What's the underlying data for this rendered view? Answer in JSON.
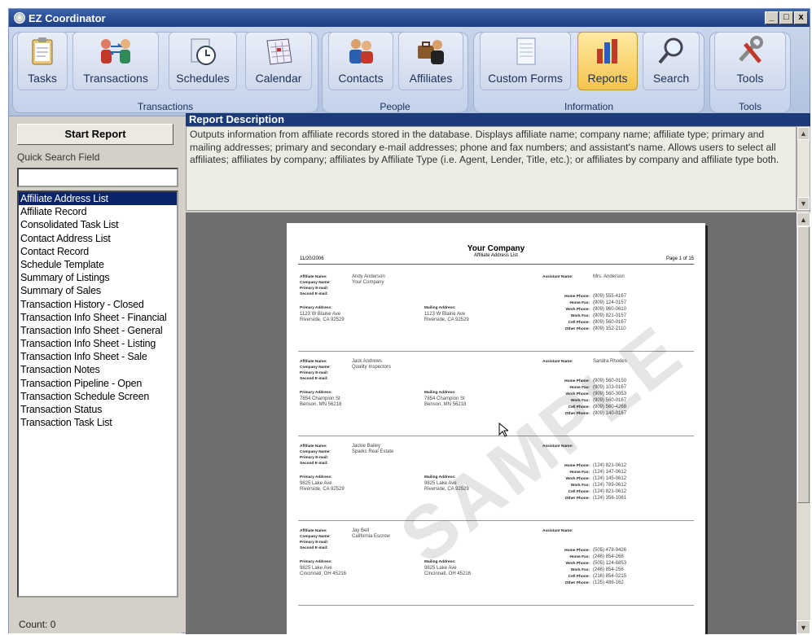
{
  "window": {
    "title": "EZ Coordinator",
    "minimize": "_",
    "restore": "□",
    "close": "x"
  },
  "ribbon": {
    "groups": [
      {
        "label": "Transactions"
      },
      {
        "label": "People"
      },
      {
        "label": "Information"
      },
      {
        "label": "Tools"
      }
    ],
    "buttons": [
      {
        "label": "Tasks",
        "icon": "clipboard-icon"
      },
      {
        "label": "Transactions",
        "icon": "people-exchange-icon"
      },
      {
        "label": "Schedules",
        "icon": "clock-icon"
      },
      {
        "label": "Calendar",
        "icon": "calendar-icon"
      },
      {
        "label": "Contacts",
        "icon": "contacts-icon"
      },
      {
        "label": "Affiliates",
        "icon": "briefcase-person-icon"
      },
      {
        "label": "Custom Forms",
        "icon": "form-icon"
      },
      {
        "label": "Reports",
        "icon": "bar-chart-icon"
      },
      {
        "label": "Search",
        "icon": "magnifier-icon"
      },
      {
        "label": "Tools",
        "icon": "wrench-icon"
      }
    ]
  },
  "left": {
    "start_report": "Start Report",
    "quick_search_label": "Quick Search Field",
    "quick_search_value": "",
    "reports": [
      "Affiliate Address List",
      "Affiliate Record",
      "Consolidated Task List",
      "Contact Address List",
      "Contact Record",
      "Schedule Template",
      "Summary of Listings",
      "Summary of Sales",
      "Transaction History - Closed",
      "Transaction Info Sheet - Financial",
      "Transaction Info Sheet - General",
      "Transaction Info Sheet - Listing",
      "Transaction Info Sheet - Sale",
      "Transaction Notes",
      "Transaction Pipeline - Open",
      "Transaction Schedule Screen",
      "Transaction Status",
      "Transaction Task List"
    ],
    "selected_index": 0,
    "count": "Count: 0"
  },
  "description": {
    "heading": "Report Description",
    "text": "Outputs information from affiliate records stored in the database. Displays affiliate name; company name; affiliate type; primary and mailing addresses; primary and secondary e-mail addresses; phone and fax numbers; and assistant's name. Allows users to select all affiliates; affiliates by company; affiliates by Affiliate Type (i.e. Agent, Lender, Title, etc.); or affiliates by company and affiliate type both."
  },
  "preview": {
    "company": "Your Company",
    "subtitle": "Affiliate Address List",
    "date": "11/20/2006",
    "page": "Page 1 of 15",
    "watermark": "SAMPLE",
    "labels": {
      "name": "Affiliate Name:",
      "company": "Company Name:",
      "email1": "Primary E-mail:",
      "email2": "Second E-mail:",
      "paddr": "Primary Address:",
      "maddr": "Mailing Address:",
      "assistant": "Assistant Name:",
      "home": "Home Phone:",
      "homefax": "Home Fax:",
      "work": "Work Phone:",
      "workfax": "Work Fax:",
      "cell": "Cell Phone:",
      "other": "Other Phone:"
    },
    "records": [
      {
        "name": "Andy Anderson",
        "company": "Your Company",
        "assistant": "Mrs. Anderson",
        "paddr1": "1123 W Blaine Ave",
        "paddr2": "Riverside, CA 92529",
        "maddr1": "1123 W Blaine Ave",
        "maddr2": "Riverside, CA 92529",
        "phones": [
          "(909) 555-4167",
          "(909) 124-0157",
          "(909) 960-0610",
          "(909) 821-0157",
          "(909) 560-0167",
          "(909) 152-2110"
        ]
      },
      {
        "name": "Jack Andrews",
        "company": "Quality Inspectors",
        "assistant": "Sandra Rhodes",
        "paddr1": "7854 Champion St",
        "paddr2": "Benson, MN 56218",
        "maddr1": "7854 Champion St",
        "maddr2": "Benson, MN 56218",
        "phones": [
          "(909) 560-0150",
          "(909) 103-0167",
          "(909) 560-3053",
          "(909) 560-0167",
          "(909) 560-4268",
          "(909) 140-0167"
        ]
      },
      {
        "name": "Jackie Bailey",
        "company": "Sparks Real Estate",
        "assistant": "",
        "paddr1": "9825 Lake Ave",
        "paddr2": "Riverside, CA 92529",
        "maddr1": "9825 Lake Ave",
        "maddr2": "Riverside, CA 92529",
        "phones": [
          "(124) 821-0612",
          "(124) 147-0612",
          "(124) 145-0612",
          "(124) 789-0612",
          "(124) 821-0612",
          "(124) 356-1061"
        ]
      },
      {
        "name": "Jay Bell",
        "company": "California Escrow",
        "assistant": "",
        "paddr1": "9825 Lake Ave",
        "paddr2": "Cincinnati, OH 45216",
        "maddr1": "9825 Lake Ave",
        "maddr2": "Cincinnati, OH 45216",
        "phones": [
          "(505) 478-9426",
          "(246) 854-268",
          "(505) 124-6853",
          "(246) 854-256",
          "(216) 854-0215",
          "(125) 486-162"
        ]
      }
    ]
  }
}
